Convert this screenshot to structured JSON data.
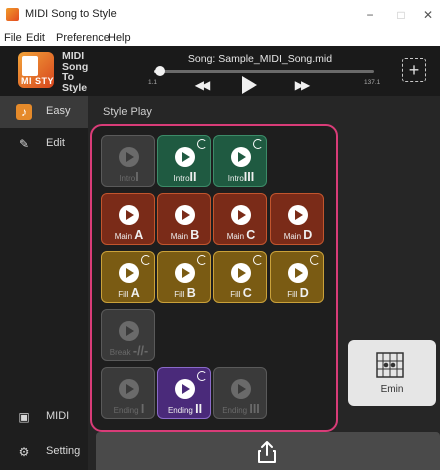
{
  "window": {
    "title": "MIDI Song to Style",
    "controls": {
      "minimize": "−",
      "maximize": "□",
      "close": "✕"
    }
  },
  "menu": [
    "File",
    "Edit",
    "Preference",
    "Help"
  ],
  "header": {
    "logo_lines": [
      "MIDI",
      "Song",
      "To",
      "Style"
    ],
    "logo_badge": "MI STY",
    "song_label": "Song: Sample_MIDI_Song.mid",
    "progress_fraction": 0.03,
    "time_start": "1.1",
    "time_end": "137.1",
    "add_label": "+"
  },
  "sidebar": {
    "items": [
      {
        "id": "easy",
        "label": "Easy",
        "icon": "guitar-icon",
        "selected": true
      },
      {
        "id": "edit",
        "label": "Edit",
        "icon": "edit-icon",
        "selected": false
      },
      {
        "id": "midi",
        "label": "MIDI",
        "icon": "midi-icon",
        "selected": false
      },
      {
        "id": "setting",
        "label": "Setting",
        "icon": "gear-icon",
        "selected": false
      }
    ]
  },
  "main": {
    "section_label": "Style Play",
    "pads": {
      "intro": [
        {
          "prefix": "Intro",
          "numeral": "I",
          "state": "disabled",
          "loop": false
        },
        {
          "prefix": "Intro",
          "numeral": "II",
          "state": "active",
          "loop": true
        },
        {
          "prefix": "Intro",
          "numeral": "III",
          "state": "active",
          "loop": true
        }
      ],
      "main": [
        {
          "prefix": "Main",
          "numeral": "A",
          "state": "active",
          "loop": false
        },
        {
          "prefix": "Main",
          "numeral": "B",
          "state": "active",
          "loop": false
        },
        {
          "prefix": "Main",
          "numeral": "C",
          "state": "active",
          "loop": false
        },
        {
          "prefix": "Main",
          "numeral": "D",
          "state": "active",
          "loop": false
        }
      ],
      "fill": [
        {
          "prefix": "Fill",
          "numeral": "A",
          "state": "active",
          "loop": true
        },
        {
          "prefix": "Fill",
          "numeral": "B",
          "state": "active",
          "loop": true
        },
        {
          "prefix": "Fill",
          "numeral": "C",
          "state": "active",
          "loop": true
        },
        {
          "prefix": "Fill",
          "numeral": "D",
          "state": "active",
          "loop": true
        }
      ],
      "break": [
        {
          "prefix": "Break",
          "numeral": "-//-",
          "state": "disabled",
          "loop": false
        }
      ],
      "ending": [
        {
          "prefix": "Ending",
          "numeral": "I",
          "state": "disabled",
          "loop": false
        },
        {
          "prefix": "Ending",
          "numeral": "II",
          "state": "active",
          "loop": true
        },
        {
          "prefix": "Ending",
          "numeral": "III",
          "state": "disabled",
          "loop": false
        }
      ]
    },
    "chord": {
      "name": "Emin"
    }
  },
  "colors": {
    "highlight_border": "#d93c78",
    "intro_active": "#1f5a41",
    "main_active": "#7a2b18",
    "fill_active": "#7a5b13",
    "ending_active": "#4a2a7a",
    "easy_accent": "#e58a2a"
  }
}
